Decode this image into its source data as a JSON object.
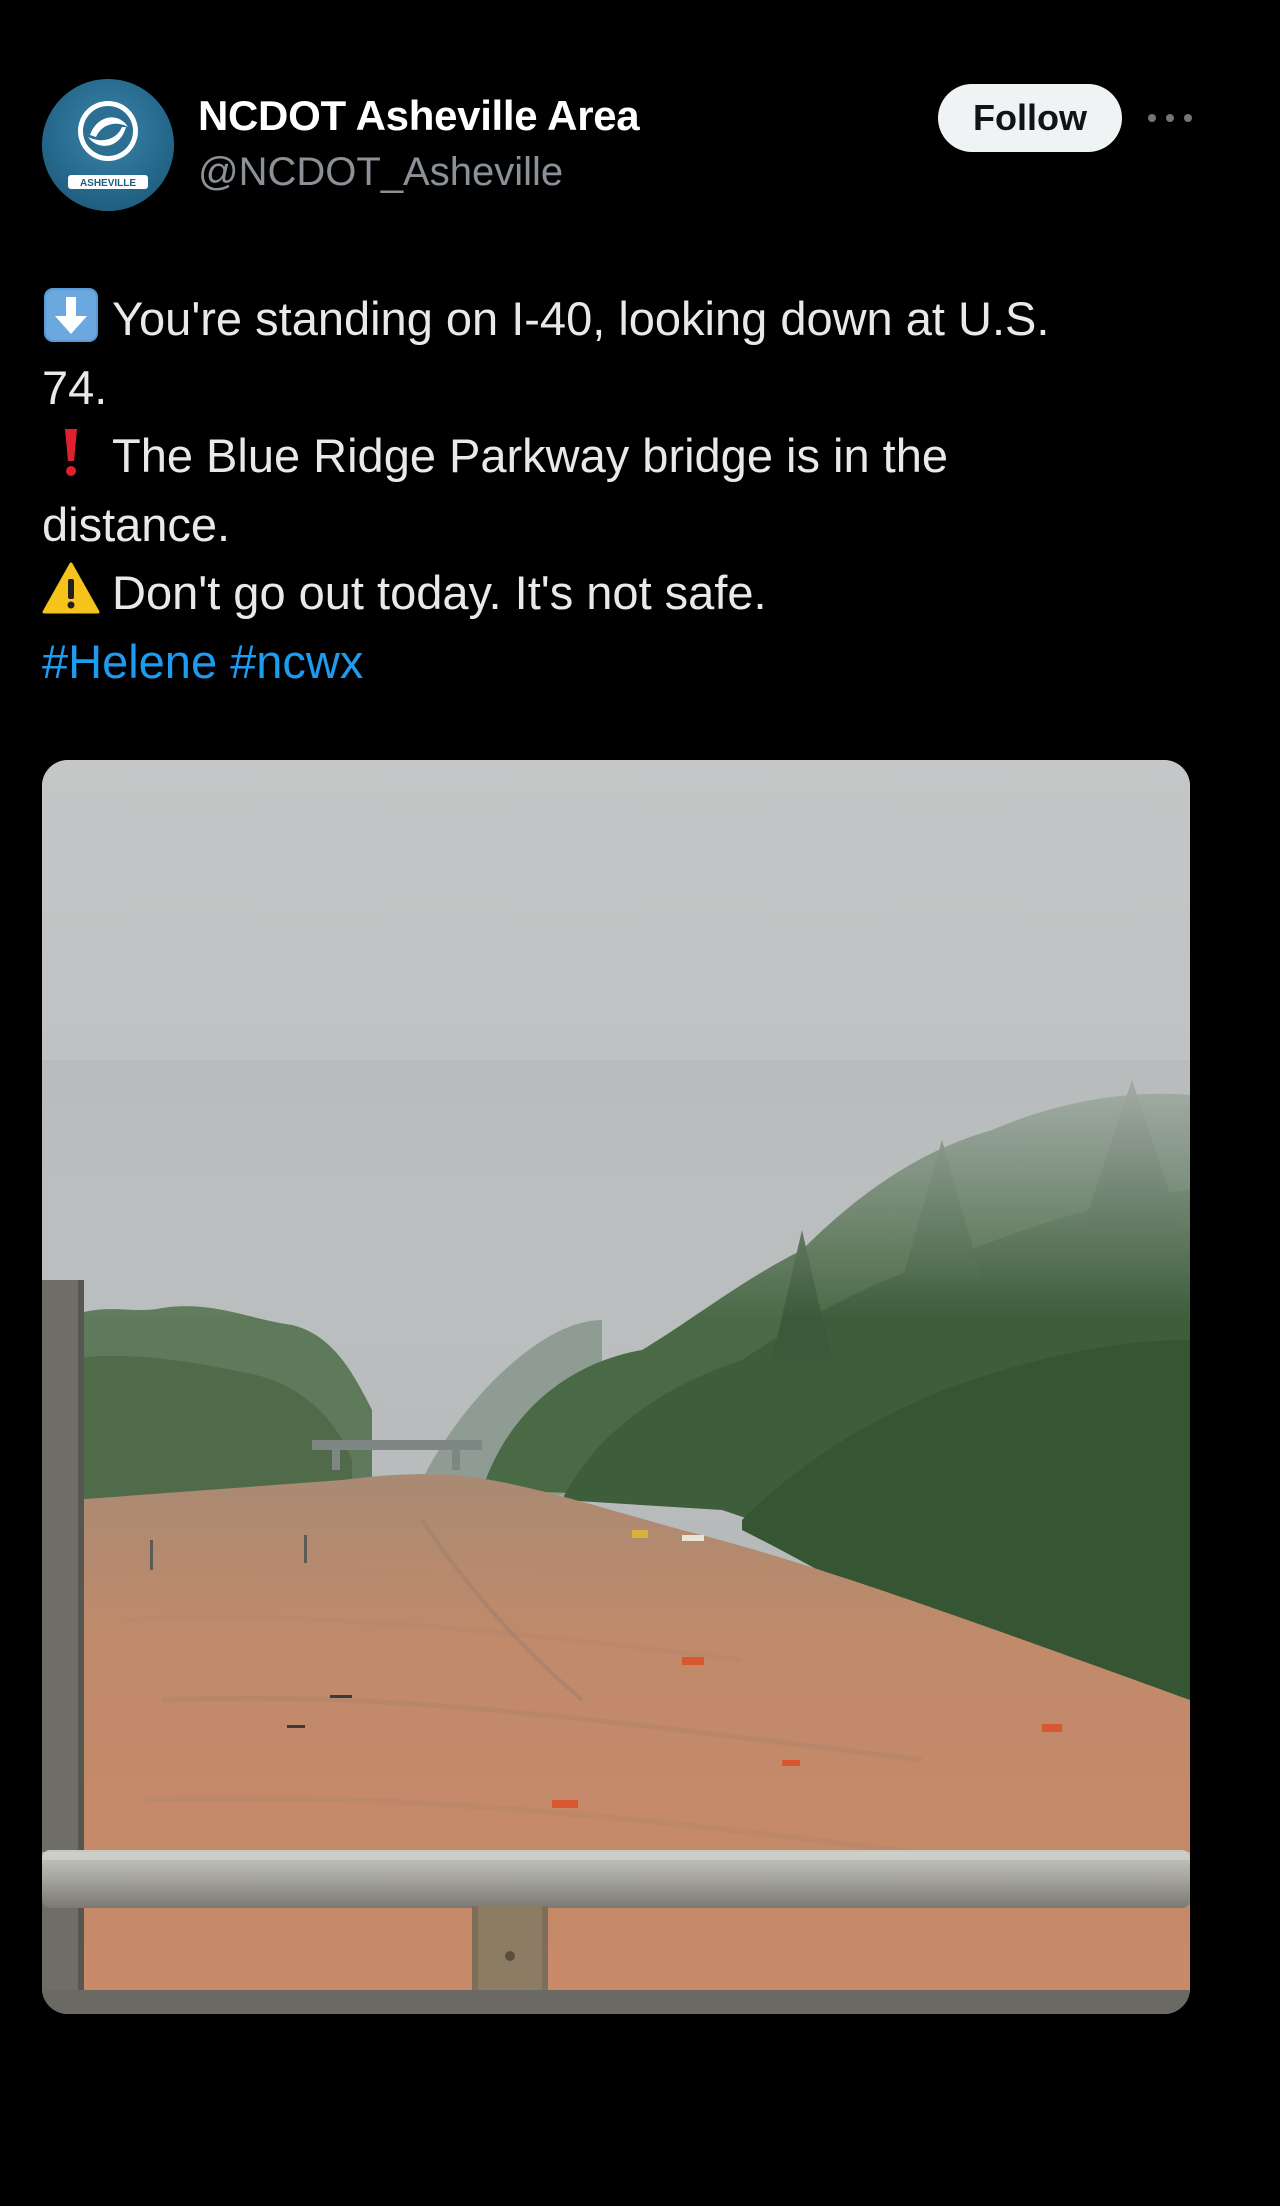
{
  "account": {
    "display_name": "NCDOT Asheville Area",
    "handle": "@NCDOT_Asheville",
    "avatar_text": "ASHEVILLE"
  },
  "actions": {
    "follow_label": "Follow",
    "more_icon": "more-horizontal-icon"
  },
  "post": {
    "lines": [
      {
        "emoji": "down-arrow-emoji",
        "text": "You're standing on I-40, looking down at U.S."
      },
      {
        "emoji": "",
        "text": "74."
      },
      {
        "emoji": "exclamation-emoji",
        "text": "The Blue Ridge Parkway bridge is in the"
      },
      {
        "emoji": "",
        "text": "distance."
      },
      {
        "emoji": "warning-emoji",
        "text": "Don't go out today. It's not safe."
      }
    ],
    "hashtags": [
      "#Helene",
      "#ncwx"
    ]
  },
  "media": {
    "type": "photo"
  },
  "colors": {
    "background": "#000000",
    "text": "#e7e9ea",
    "secondary_text": "#8b9197",
    "link": "#1d9bf0",
    "follow_bg": "#eff3f4",
    "flood_water": "#c1886a"
  }
}
